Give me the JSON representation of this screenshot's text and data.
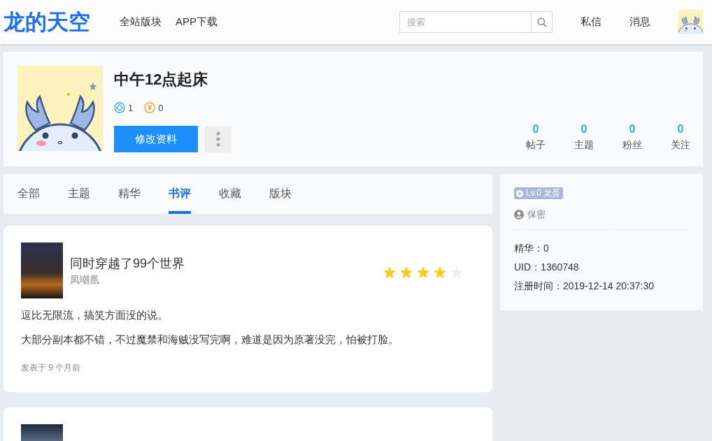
{
  "header": {
    "logo": "龙的天空",
    "nav": [
      {
        "label": "全站版块"
      },
      {
        "label": "APP下载"
      }
    ],
    "search": {
      "placeholder": "搜索"
    },
    "links": [
      {
        "label": "私信"
      },
      {
        "label": "消息"
      }
    ]
  },
  "profile": {
    "name": "中午12点起床",
    "badges": [
      {
        "kind": "diamond",
        "value": "1"
      },
      {
        "kind": "coin",
        "value": "0"
      }
    ],
    "edit_button": "修改资料",
    "stats": [
      {
        "value": "0",
        "label": "帖子"
      },
      {
        "value": "0",
        "label": "主题"
      },
      {
        "value": "0",
        "label": "粉丝"
      },
      {
        "value": "0",
        "label": "关注"
      }
    ]
  },
  "tabs": [
    {
      "label": "全部",
      "selected": false
    },
    {
      "label": "主题",
      "selected": false
    },
    {
      "label": "精华",
      "selected": false
    },
    {
      "label": "书评",
      "selected": true
    },
    {
      "label": "收藏",
      "selected": false
    },
    {
      "label": "版块",
      "selected": false
    }
  ],
  "reviews": [
    {
      "kind": "full",
      "title": "同时穿越了99个世界",
      "author": "凤嘲凰",
      "stars": 4,
      "paragraphs": [
        "逗比无限流，搞笑方面没的说。",
        "大部分副本都不错，不过魔禁和海贼没写完啊，难道是因为原著没完，怕被打脸。"
      ],
      "posted": "发表于 9 个月前"
    },
    {
      "kind": "clipped"
    }
  ],
  "sidebar": {
    "level_badge": "Lv.0 龙蛋",
    "gender": "保密",
    "details": [
      "精华：0",
      "UID：1360748",
      "注册时间：2019-12-14 20:37:30"
    ]
  }
}
